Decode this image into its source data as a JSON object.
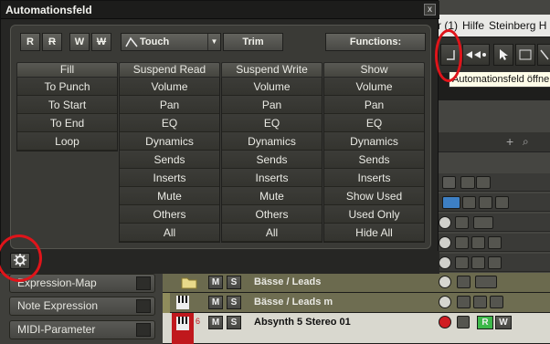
{
  "window": {
    "title": "Automationsfeld",
    "close_label": "x"
  },
  "toolbar": {
    "modes": [
      "R",
      "R",
      "W",
      "W"
    ],
    "touch_mode": "Touch",
    "trim_label": "Trim",
    "functions_label": "Functions:"
  },
  "columns": [
    {
      "header": "Fill",
      "items": [
        "To Punch",
        "To Start",
        "To End",
        "Loop"
      ]
    },
    {
      "header": "Suspend Read",
      "items": [
        "Volume",
        "Pan",
        "EQ",
        "Dynamics",
        "Sends",
        "Inserts",
        "Mute",
        "Others",
        "All"
      ]
    },
    {
      "header": "Suspend Write",
      "items": [
        "Volume",
        "Pan",
        "EQ",
        "Dynamics",
        "Sends",
        "Inserts",
        "Mute",
        "Others",
        "All"
      ]
    },
    {
      "header": "Show",
      "items": [
        "Volume",
        "Pan",
        "EQ",
        "Dynamics",
        "Sends",
        "Inserts",
        "Show Used",
        "Used Only",
        "Hide All"
      ]
    }
  ],
  "background_app": {
    "menu": [
      "r (1)",
      "Hilfe",
      "Steinberg H"
    ],
    "tooltip": "Automationsfeld öffnen",
    "inspector": [
      "Expression-Map",
      "Note Expression",
      "MIDI-Parameter"
    ],
    "tracks": [
      {
        "name": "Bässe / Leads",
        "number": ""
      },
      {
        "name": "Bässe / Leads m",
        "number": ""
      },
      {
        "name": "Absynth 5 Stereo 01",
        "number": "6"
      }
    ],
    "track_buttons": {
      "mute": "M",
      "solo": "S",
      "read": "R",
      "write": "W"
    }
  },
  "colors": {
    "highlight_circle": "#e0141a",
    "track_green": "#3db84a",
    "track_red_marker": "#c0181d"
  }
}
